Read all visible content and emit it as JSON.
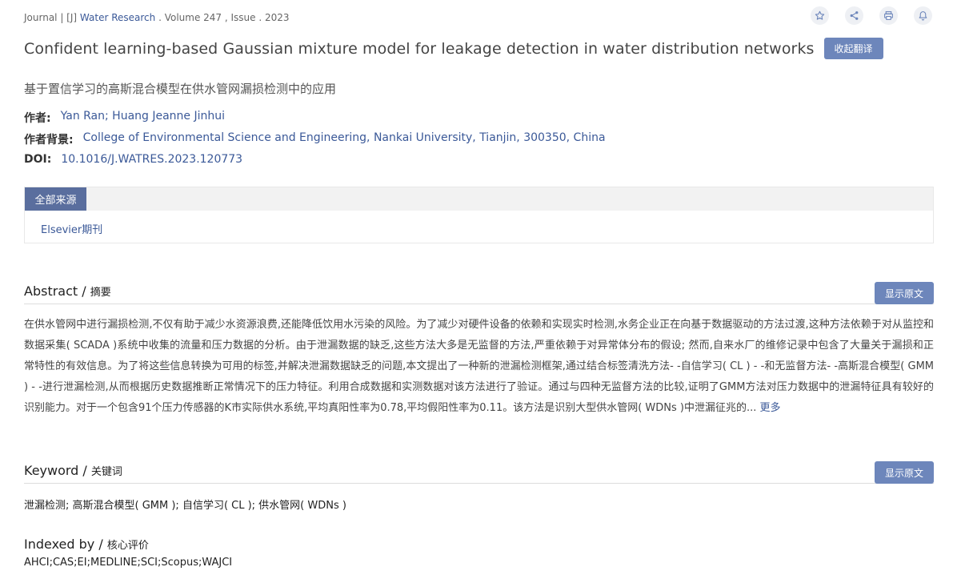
{
  "header": {
    "type_prefix": "Journal | [J]",
    "journal_name": "Water Research",
    "volume_issue": ". Volume 247 , Issue . 2023"
  },
  "actions": {
    "icons": [
      "star-icon",
      "share-icon",
      "print-icon",
      "bell-icon"
    ]
  },
  "paper": {
    "title_en": "Confident learning-based Gaussian mixture model for leakage detection in water distribution networks",
    "collapse_translation_label": "收起翻译",
    "title_cn": "基于置信学习的高斯混合模型在供水管网漏损检测中的应用",
    "authors_label": "作者:",
    "authors": "Yan Ran; Huang Jeanne Jinhui",
    "affiliation_label": "作者背景:",
    "affiliation": "College of Environmental Science and Engineering, Nankai University, Tianjin, 300350, China",
    "doi_label": "DOI:",
    "doi": "10.1016/J.WATRES.2023.120773"
  },
  "sources": {
    "tab_label": "全部来源",
    "items": [
      "Elsevier期刊"
    ]
  },
  "abstract": {
    "title_en": "Abstract /",
    "title_cn": "摘要",
    "show_original_label": "显示原文",
    "text": "在供水管网中进行漏损检测,不仅有助于减少水资源浪费,还能降低饮用水污染的风险。为了减少对硬件设备的依赖和实现实时检测,水务企业正在向基于数据驱动的方法过渡,这种方法依赖于对从监控和数据采集( SCADA )系统中收集的流量和压力数据的分析。由于泄漏数据的缺乏,这些方法大多是无监督的方法,严重依赖于对异常体分布的假设; 然而,自来水厂的维修记录中包含了大量关于漏损和正常特性的有效信息。为了将这些信息转换为可用的标签,并解决泄漏数据缺乏的问题,本文提出了一种新的泄漏检测框架,通过结合标签清洗方法- -自信学习( CL ) - -和无监督方法- -高斯混合模型( GMM ) - -进行泄漏检测,从而根据历史数据推断正常情况下的压力特征。利用合成数据和实测数据对该方法进行了验证。通过与四种无监督方法的比较,证明了GMM方法对压力数据中的泄漏特征具有较好的识别能力。对于一个包含91个压力传感器的K市实际供水系统,平均真阳性率为0.78,平均假阳性率为0.11。该方法是识别大型供水管网( WDNs )中泄漏征兆的...",
    "more_label": "更多"
  },
  "keyword": {
    "title_en": "Keyword /",
    "title_cn": "关键词",
    "show_original_label": "显示原文",
    "text": "泄漏检测; 高斯混合模型( GMM ); 自信学习( CL ); 供水管网( WDNs )"
  },
  "indexed": {
    "title_en": "Indexed by /",
    "title_cn": "核心评价",
    "text": "AHCI;CAS;EI;MEDLINE;SCI;Scopus;WAJCI"
  },
  "colors": {
    "accent": "#6d86bb",
    "tab_active": "#5a6e9e",
    "link": "#3b5998"
  }
}
